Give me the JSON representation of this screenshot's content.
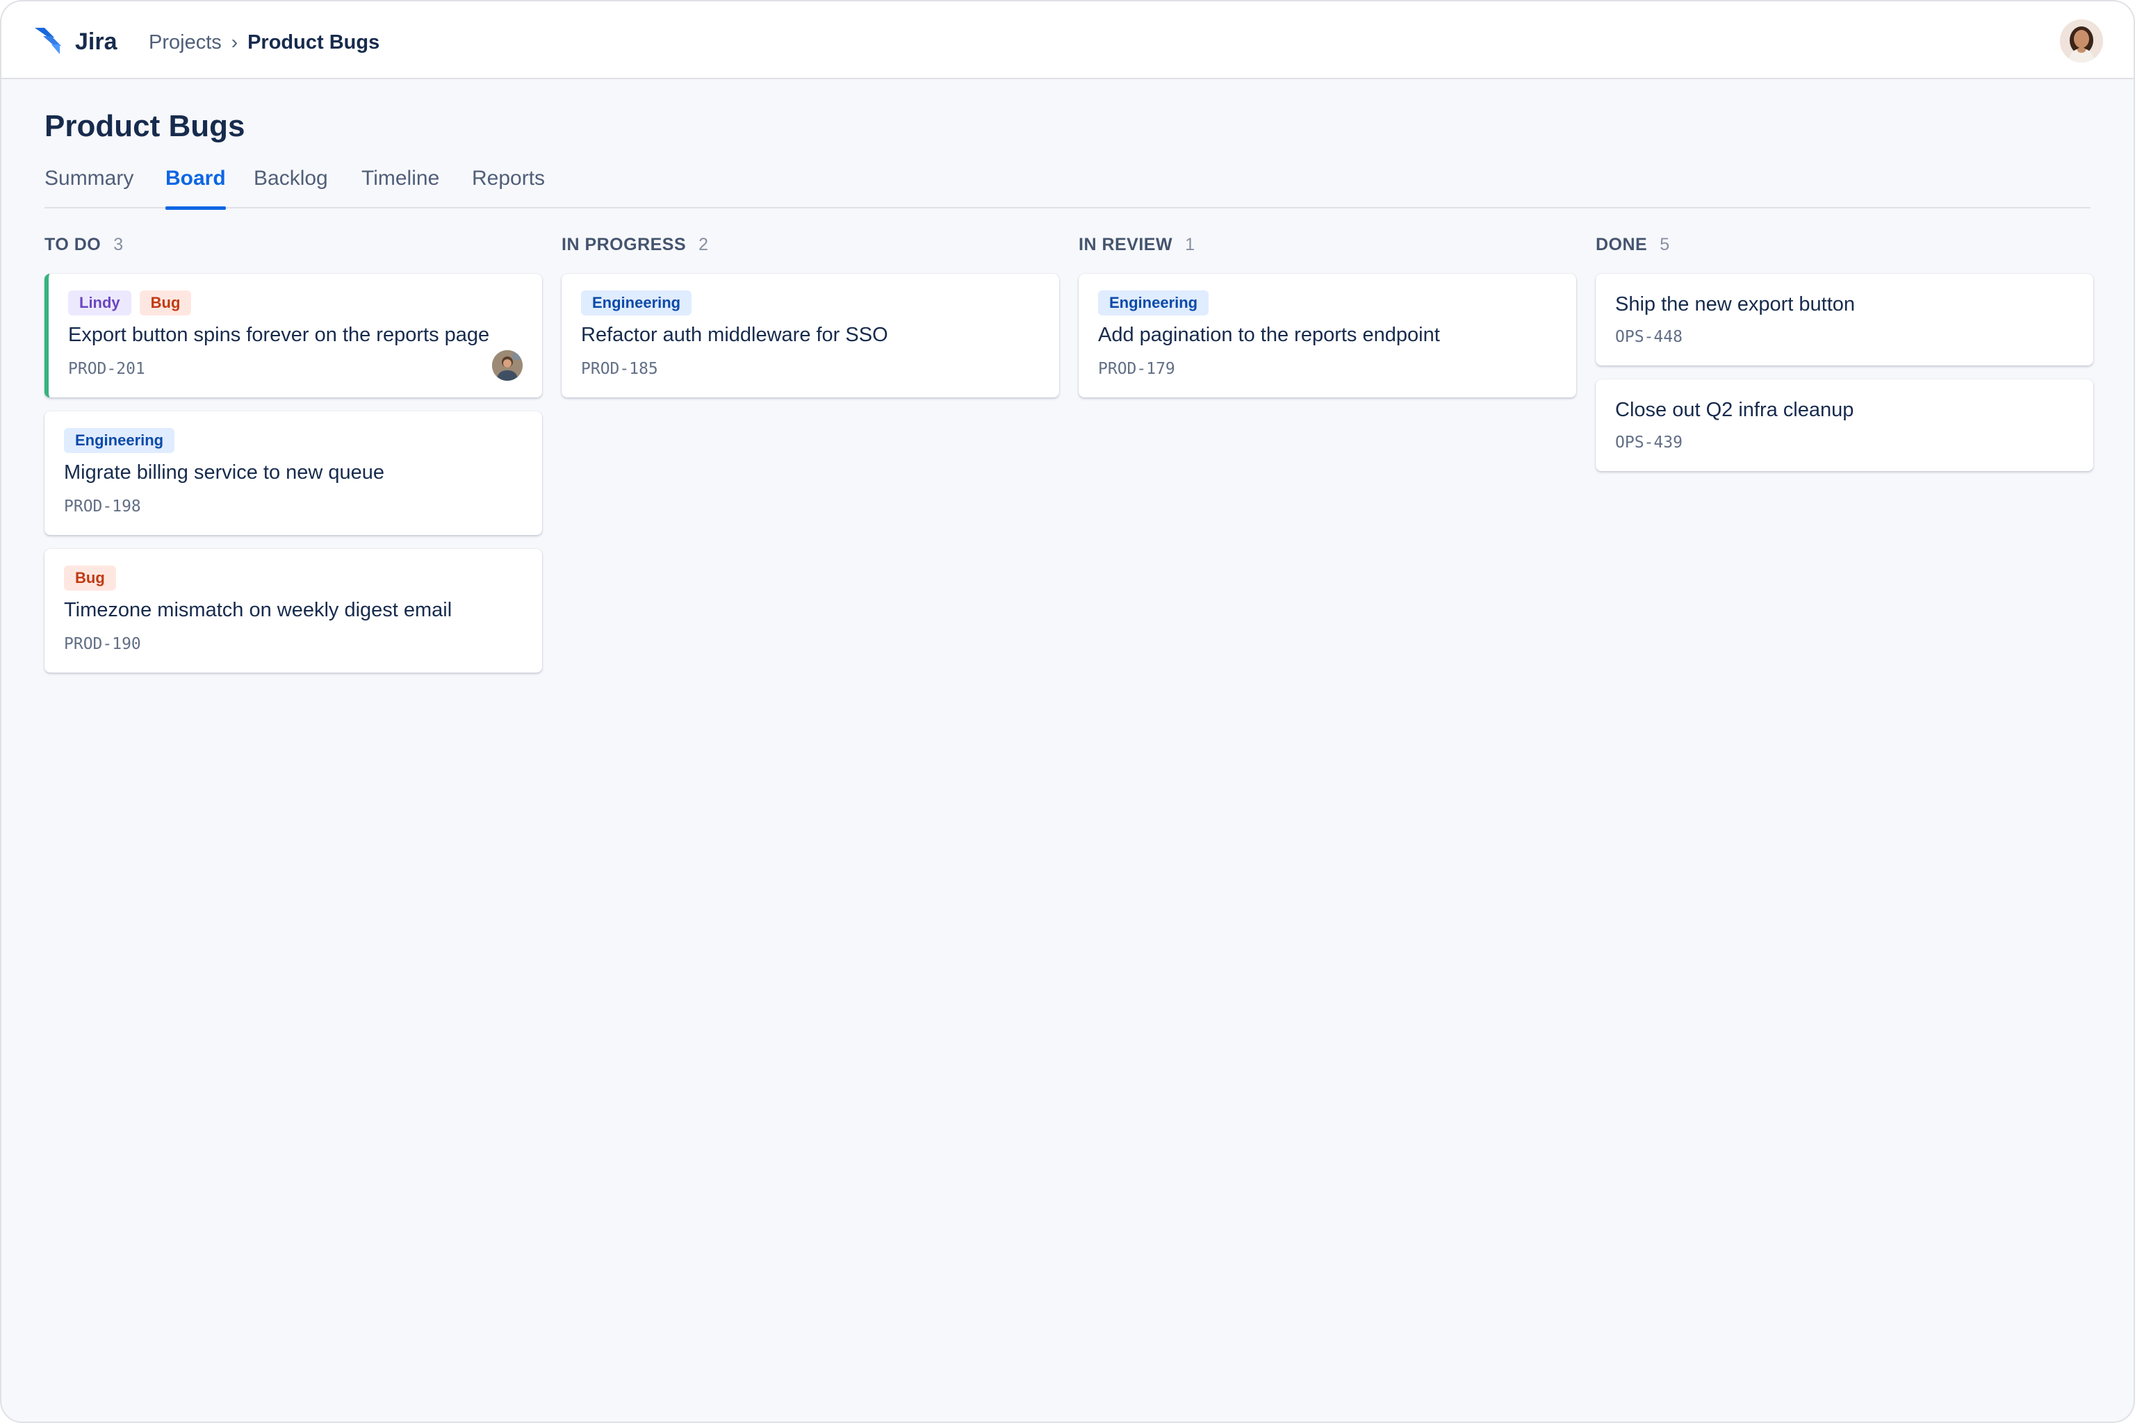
{
  "app": {
    "name": "Jira"
  },
  "breadcrumb": {
    "parent": "Projects",
    "separator": "›",
    "current": "Product Bugs"
  },
  "page": {
    "title": "Product Bugs"
  },
  "tabs": [
    {
      "label": "Summary",
      "active": false
    },
    {
      "label": "Board",
      "active": true
    },
    {
      "label": "Backlog",
      "active": false
    },
    {
      "label": "Timeline",
      "active": false
    },
    {
      "label": "Reports",
      "active": false
    }
  ],
  "board": {
    "columns": [
      {
        "title": "TO DO",
        "count": "3",
        "cards": [
          {
            "labels": [
              {
                "text": "Lindy",
                "kind": "lindy"
              },
              {
                "text": "Bug",
                "kind": "bug"
              }
            ],
            "title": "Export button spins forever on the reports page",
            "key": "PROD-201",
            "has_assignee": true,
            "highlight": true
          },
          {
            "labels": [
              {
                "text": "Engineering",
                "kind": "eng"
              }
            ],
            "title": "Migrate billing service to new queue",
            "key": "PROD-198"
          },
          {
            "labels": [
              {
                "text": "Bug",
                "kind": "bug"
              }
            ],
            "title": "Timezone mismatch on weekly digest email",
            "key": "PROD-190"
          }
        ]
      },
      {
        "title": "IN PROGRESS",
        "count": "2",
        "cards": [
          {
            "labels": [
              {
                "text": "Engineering",
                "kind": "eng"
              }
            ],
            "title": "Refactor auth middleware for SSO",
            "key": "PROD-185"
          }
        ]
      },
      {
        "title": "IN REVIEW",
        "count": "1",
        "cards": [
          {
            "labels": [
              {
                "text": "Engineering",
                "kind": "eng"
              }
            ],
            "title": "Add pagination to the reports endpoint",
            "key": "PROD-179"
          }
        ]
      },
      {
        "title": "DONE",
        "count": "5",
        "cards": [
          {
            "labels": [],
            "title": "Ship the new export button",
            "key": "OPS-448"
          },
          {
            "labels": [],
            "title": "Close out Q2 infra cleanup",
            "key": "OPS-439"
          }
        ]
      }
    ]
  },
  "colors": {
    "accent": "#0c66e4",
    "highlight_border": "#36b37e",
    "label_engineering_bg": "#e0ecff",
    "label_bug_bg": "#ffe7e1",
    "label_lindy_bg": "#ece9ff"
  },
  "icons": {
    "logo": "jira-logo-icon",
    "avatar": "user-avatar",
    "assignee": "assignee-avatar"
  }
}
